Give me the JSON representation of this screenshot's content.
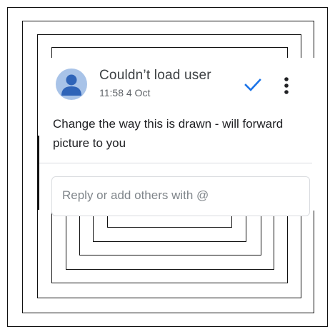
{
  "comment": {
    "author": "Couldn’t load user",
    "timestamp": "11:58 4 Oct",
    "body": "Change the way this is drawn - will forward picture to you",
    "resolve_icon": "checkmark-icon",
    "more_icon": "vertical-dots-icon",
    "accent_color": "#1a73e8"
  },
  "reply": {
    "placeholder": "Reply or add others with @"
  }
}
